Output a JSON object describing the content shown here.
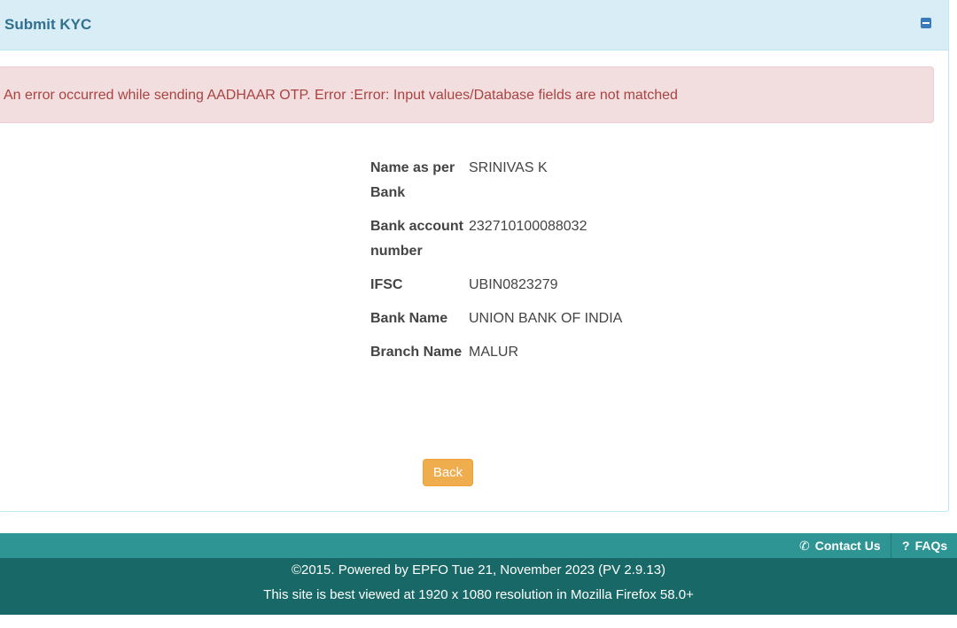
{
  "panel": {
    "title": "Submit KYC",
    "collapse_icon": "minus-square-icon"
  },
  "alert": {
    "message": "An error occurred while sending AADHAAR OTP. Error :Error: Input values/Database fields are not matched"
  },
  "details": [
    {
      "label": "Name as per Bank",
      "value": "SRINIVAS K"
    },
    {
      "label": "Bank account number",
      "value": "232710100088032"
    },
    {
      "label": "IFSC",
      "value": "UBIN0823279"
    },
    {
      "label": "Bank Name",
      "value": "UNION BANK OF INDIA"
    },
    {
      "label": "Branch Name",
      "value": "MALUR"
    }
  ],
  "actions": {
    "back_label": "Back",
    "back_color": "#f0ad4e"
  },
  "footer": {
    "links": [
      {
        "label": "Contact Us",
        "icon": "phone-icon"
      },
      {
        "label": "FAQs",
        "icon": "question-icon"
      }
    ],
    "copyright": "©2015. Powered by EPFO Tue 21, November 2023 (PV 2.9.13)",
    "note": "This site is best viewed at 1920 x 1080 resolution in Mozilla Firefox 58.0+",
    "colors": {
      "top_bar": "#2e9494",
      "bottom_bar": "#176866"
    }
  }
}
